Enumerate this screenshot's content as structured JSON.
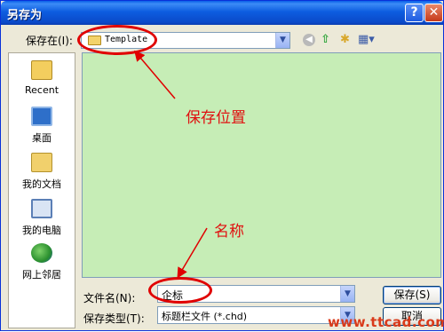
{
  "window": {
    "title": "另存为"
  },
  "toolbar": {
    "save_in_label": "保存在(I):",
    "location_value": "Template",
    "icons": [
      "back-icon",
      "up-folder-icon",
      "new-folder-icon",
      "views-menu-icon"
    ]
  },
  "places": [
    {
      "label": "Recent",
      "icon": "recent-folder-icon"
    },
    {
      "label": "桌面",
      "icon": "desktop-icon"
    },
    {
      "label": "我的文档",
      "icon": "my-documents-icon"
    },
    {
      "label": "我的电脑",
      "icon": "my-computer-icon"
    },
    {
      "label": "网上邻居",
      "icon": "network-places-icon"
    }
  ],
  "annotations": {
    "location": "保存位置",
    "name": "名称"
  },
  "form": {
    "filename_label": "文件名(N):",
    "filename_value": "企标",
    "filetype_label": "保存类型(T):",
    "filetype_value": "标题栏文件 (*.chd)"
  },
  "buttons": {
    "save": "保存(S)",
    "cancel": "取消"
  },
  "watermark": "www.ttcad.com",
  "colors": {
    "titlebar": "#0A5FE8",
    "dialog_bg": "#ECE9D8",
    "file_area": "#C6EDB6",
    "annotation_red": "#E00000"
  }
}
